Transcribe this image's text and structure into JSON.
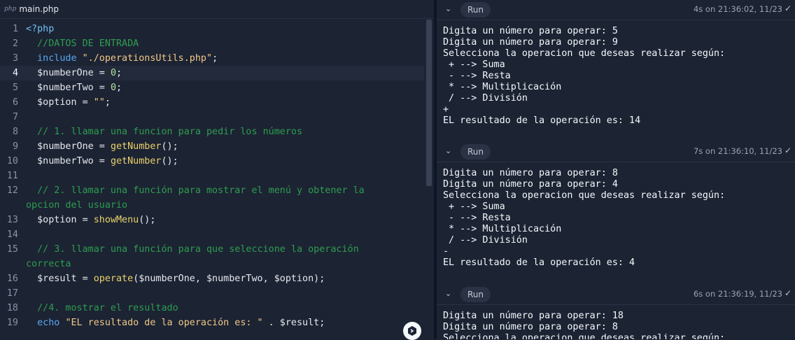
{
  "editor": {
    "tab": {
      "badge": "php",
      "filename": "main.php"
    },
    "lines": [
      {
        "n": "1",
        "segs": [
          [
            "tag",
            "<?php"
          ]
        ]
      },
      {
        "n": "2",
        "segs": [
          [
            "cmt",
            "  //DATOS DE ENTRADA"
          ]
        ]
      },
      {
        "n": "3",
        "segs": [
          [
            "kw",
            "  include"
          ],
          [
            "var",
            " "
          ],
          [
            "str",
            "\"./operationsUtils.php\""
          ],
          [
            "var",
            ";"
          ]
        ]
      },
      {
        "n": "4",
        "active": true,
        "segs": [
          [
            "var",
            "  $numberOne = "
          ],
          [
            "num",
            "0"
          ],
          [
            "var",
            ";"
          ]
        ]
      },
      {
        "n": "5",
        "segs": [
          [
            "var",
            "  $numberTwo = "
          ],
          [
            "num",
            "0"
          ],
          [
            "var",
            ";"
          ]
        ]
      },
      {
        "n": "6",
        "segs": [
          [
            "var",
            "  $option = "
          ],
          [
            "str",
            "\"\""
          ],
          [
            "var",
            ";"
          ]
        ]
      },
      {
        "n": "7",
        "segs": []
      },
      {
        "n": "8",
        "segs": [
          [
            "cmt",
            "  // 1. llamar una funcion para pedir los números"
          ]
        ]
      },
      {
        "n": "9",
        "segs": [
          [
            "var",
            "  $numberOne = "
          ],
          [
            "fn",
            "getNumber"
          ],
          [
            "var",
            "();"
          ]
        ]
      },
      {
        "n": "10",
        "segs": [
          [
            "var",
            "  $numberTwo = "
          ],
          [
            "fn",
            "getNumber"
          ],
          [
            "var",
            "();"
          ]
        ]
      },
      {
        "n": "11",
        "segs": []
      },
      {
        "n": "12",
        "wrap": true,
        "segs": [
          [
            "cmt",
            "  // 2. llamar una función para mostrar el menú y obtener la\nopcion del usuario"
          ]
        ]
      },
      {
        "n": "13",
        "segs": [
          [
            "var",
            "  $option = "
          ],
          [
            "fn",
            "showMenu"
          ],
          [
            "var",
            "();"
          ]
        ]
      },
      {
        "n": "14",
        "segs": []
      },
      {
        "n": "15",
        "wrap": true,
        "segs": [
          [
            "cmt",
            "  // 3. llamar una función para que seleccione la operación\ncorrecta"
          ]
        ]
      },
      {
        "n": "16",
        "segs": [
          [
            "var",
            "  $result = "
          ],
          [
            "fn",
            "operate"
          ],
          [
            "var",
            "($numberOne, $numberTwo, $option);"
          ]
        ]
      },
      {
        "n": "17",
        "segs": []
      },
      {
        "n": "18",
        "segs": [
          [
            "cmt",
            "  //4. mostrar el resultado"
          ]
        ]
      },
      {
        "n": "19",
        "segs": [
          [
            "kw",
            "  echo"
          ],
          [
            "var",
            " "
          ],
          [
            "str",
            "\"EL resultado de la operación es: \""
          ],
          [
            "var",
            " . $result;"
          ]
        ]
      }
    ]
  },
  "console": {
    "runs": [
      {
        "run_label": "Run",
        "meta": "4s on 21:36:02, 11/23",
        "output": "Digita un número para operar: 5\nDigita un número para operar: 9\nSelecciona la operacion que deseas realizar según:\n + --> Suma\n - --> Resta\n * --> Multiplicación\n / --> División\n+\nEL resultado de la operación es: 14"
      },
      {
        "run_label": "Run",
        "meta": "7s on 21:36:10, 11/23",
        "output": "Digita un número para operar: 8\nDigita un número para operar: 4\nSelecciona la operacion que deseas realizar según:\n + --> Suma\n - --> Resta\n * --> Multiplicación\n / --> División\n-\nEL resultado de la operación es: 4"
      },
      {
        "run_label": "Run",
        "meta": "6s on 21:36:19, 11/23",
        "output": "Digita un número para operar: 18\nDigita un número para operar: 8\nSelecciona la operacion que deseas realizar según:"
      }
    ]
  },
  "colors": {
    "bg": "#1c2333",
    "comment": "#2e9e4f",
    "keyword": "#5aa8f0",
    "string": "#f0c987",
    "function": "#ead26b",
    "number": "#b4e49b"
  },
  "icons": {
    "collapse": "chevron-down-icon",
    "status": "check-icon",
    "assistant": "ai-assistant-icon"
  }
}
